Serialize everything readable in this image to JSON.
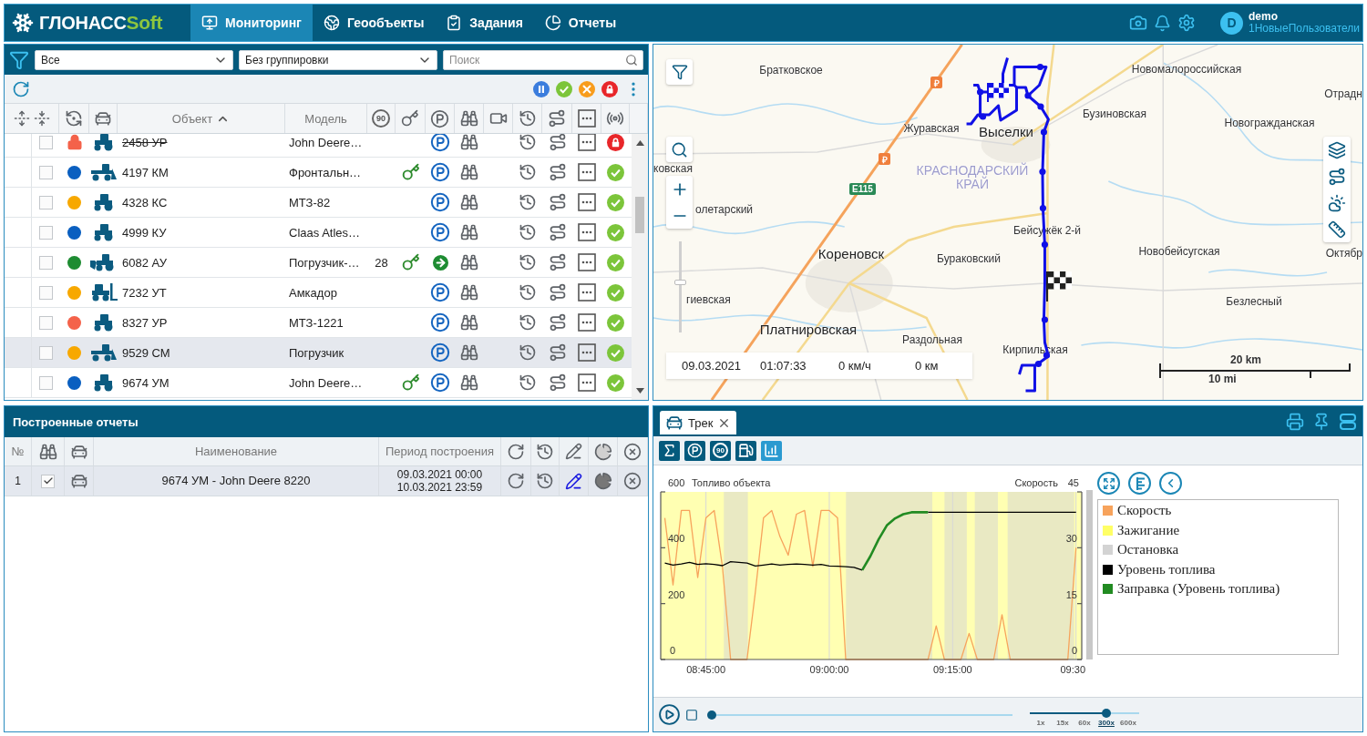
{
  "header": {
    "logo": {
      "main": "ГЛОНАСС",
      "accent": "Soft"
    },
    "nav": [
      {
        "kind": "monitoring",
        "label": "Мониторинг",
        "selected": true
      },
      {
        "kind": "geoobjects",
        "label": "Геообъекты",
        "selected": false
      },
      {
        "kind": "tasks",
        "label": "Задания",
        "selected": false
      },
      {
        "kind": "reports",
        "label": "Отчеты",
        "selected": false
      }
    ],
    "user": {
      "initial": "D",
      "name": "demo",
      "group": "1НовыеПользователи"
    }
  },
  "monitoring": {
    "filters": {
      "status": "Все",
      "grouping": "Без группировки",
      "search": {
        "placeholder": "Поиск"
      }
    },
    "table": {
      "columns": {
        "object": "Объект",
        "model": "Модель",
        "speed_limit": "90"
      },
      "sort_ascending": true,
      "rows": [
        {
          "name": "2458 УР",
          "model": "John Deere…",
          "kind": "tractor",
          "color": "#f4624a",
          "blocked": true,
          "key": false,
          "moving": false,
          "checked": false,
          "selected": false
        },
        {
          "name": "4197 КМ",
          "model": "Фронтальн…",
          "kind": "grader",
          "color": "#0a5fc0",
          "blocked": false,
          "key": true,
          "moving": false,
          "checked": false,
          "selected": false
        },
        {
          "name": "4328 КС",
          "model": "МТЗ-82",
          "kind": "tractor",
          "color": "#f7a800",
          "blocked": false,
          "key": false,
          "moving": false,
          "checked": false,
          "selected": false
        },
        {
          "name": "4999 КУ",
          "model": "Claas Atles…",
          "kind": "tractor",
          "color": "#0a5fc0",
          "blocked": false,
          "key": false,
          "moving": false,
          "checked": false,
          "selected": false
        },
        {
          "name": "6082 АУ",
          "model": "Погрузчик-…",
          "speed_limit": "28",
          "kind": "loader",
          "color": "#1e8c32",
          "blocked": false,
          "key": true,
          "moving": true,
          "checked": false,
          "selected": false
        },
        {
          "name": "7232 УТ",
          "model": "Амкадор",
          "kind": "forklift",
          "color": "#f7a800",
          "blocked": false,
          "key": false,
          "moving": false,
          "checked": false,
          "selected": false
        },
        {
          "name": "8327 УР",
          "model": "МТЗ-1221",
          "kind": "tractor",
          "color": "#f4624a",
          "blocked": false,
          "key": false,
          "moving": false,
          "checked": false,
          "selected": false
        },
        {
          "name": "9529 СМ",
          "model": "Погрузчик",
          "kind": "grader",
          "color": "#f7a800",
          "blocked": false,
          "key": false,
          "moving": false,
          "checked": false,
          "selected": true
        },
        {
          "name": "9674 УМ",
          "model": "John Deere…",
          "kind": "tractor",
          "color": "#0a5fc0",
          "blocked": false,
          "key": true,
          "moving": false,
          "checked": false,
          "selected": false
        }
      ]
    }
  },
  "map": {
    "places": [
      {
        "label": "Братковское",
        "kind": "village"
      },
      {
        "label": "Новомалороссийская",
        "kind": "village"
      },
      {
        "label": "Отрадн",
        "kind": "village"
      },
      {
        "label": "Журавская",
        "kind": "village"
      },
      {
        "label": "Выселки",
        "kind": "city"
      },
      {
        "label": "Бузиновская",
        "kind": "village"
      },
      {
        "label": "Новогражданская",
        "kind": "village"
      },
      {
        "label": "ковская",
        "kind": "village"
      },
      {
        "label": "КРАСНОДАРСКИЙ КРАЙ",
        "kind": "region"
      },
      {
        "label": "олетарский",
        "kind": "village"
      },
      {
        "label": "Кореновск",
        "kind": "city"
      },
      {
        "label": "Бураковский",
        "kind": "village"
      },
      {
        "label": "Бейсужёк 2-й",
        "kind": "village"
      },
      {
        "label": "Новобейсугская",
        "kind": "village"
      },
      {
        "label": "Октябр",
        "kind": "village"
      },
      {
        "label": "гиевская",
        "kind": "village"
      },
      {
        "label": "Безлесный",
        "kind": "village"
      },
      {
        "label": "Платнировская",
        "kind": "city"
      },
      {
        "label": "Раздольная",
        "kind": "village"
      },
      {
        "label": "Кирпильская",
        "kind": "village"
      }
    ],
    "road_sign": "E115",
    "fuel_markers": [
      "₽",
      "₽"
    ],
    "zoom_slider": {
      "level": 0.55
    },
    "info": {
      "date": "09.03.2021",
      "time": "01:07:33",
      "speed": "0 км/ч",
      "distance": "0 км"
    },
    "scale": {
      "metric": "20 km",
      "imperial": "10 mi"
    }
  },
  "reports": {
    "title": "Построенные отчеты",
    "columns": {
      "number": "№",
      "name": "Наименование",
      "period": "Период построения"
    },
    "rows": [
      {
        "number": "1",
        "checked": true,
        "selected": true,
        "name": "9674 УМ - John Deere 8220",
        "period_from": "09.03.2021 00:00",
        "period_to": "10.03.2021 23:59",
        "track_shown": true
      }
    ]
  },
  "track": {
    "tab": {
      "label": "Трек",
      "selected": true
    },
    "tools": [
      {
        "kind": "sum",
        "selected": false
      },
      {
        "kind": "parking",
        "selected": false
      },
      {
        "kind": "speed",
        "label": "90",
        "selected": false
      },
      {
        "kind": "fuel",
        "selected": false
      },
      {
        "kind": "chart",
        "selected": true
      }
    ],
    "chart": {
      "chart_data": {
        "type": "line",
        "ylabel": "Топливо объекта",
        "y2label": "Скорость",
        "grid": true,
        "legend": "right",
        "categories": [
          null,
          null,
          null,
          null,
          null,
          "08:45:00",
          null,
          null,
          null,
          null,
          null,
          null,
          null,
          null,
          null,
          null,
          null,
          null,
          null,
          null,
          "09:00:00",
          null,
          null,
          null,
          null,
          null,
          null,
          null,
          null,
          null,
          null,
          null,
          null,
          null,
          null,
          "09:15:00",
          null,
          null,
          null,
          null,
          null,
          null,
          null,
          null,
          null,
          null,
          null,
          null,
          null,
          null,
          "09:30"
        ],
        "ylim": [
          0,
          600
        ],
        "yticks": [
          0,
          200,
          400,
          600
        ],
        "y2lim": [
          0,
          45
        ],
        "y2ticks": [
          0,
          15,
          30,
          45
        ],
        "series": [
          {
            "name": "Скорость",
            "color": "#f7a35c",
            "axis": "y2",
            "values": [
              38,
              20,
              40,
              40,
              22,
              38,
              40,
              25,
              0,
              0,
              0,
              18,
              38,
              40,
              33,
              28,
              39,
              40,
              25,
              40,
              40,
              38,
              0,
              0,
              0,
              0,
              0,
              0,
              0,
              0,
              0,
              0,
              0,
              9,
              0,
              0,
              0,
              7,
              0,
              0,
              0,
              12,
              0,
              0,
              0,
              0,
              0,
              0,
              0,
              0,
              30
            ]
          },
          {
            "name": "Уровень топлива",
            "color": "#000000",
            "axis": "y",
            "values": [
              345,
              338,
              342,
              348,
              340,
              343,
              340,
              336,
              350,
              348,
              345,
              335,
              338,
              342,
              338,
              340,
              342,
              340,
              338,
              340,
              335,
              334,
              332,
              330,
              320,
              null,
              null,
              null,
              null,
              null,
              null,
              null,
              527,
              527,
              527,
              527,
              527,
              527,
              527,
              527,
              527,
              527,
              527,
              527,
              527,
              527,
              527,
              527,
              527,
              527,
              527
            ]
          },
          {
            "name": "Заправка (Уровень топлива)",
            "color": "#228b22",
            "axis": "y",
            "values": [
              null,
              null,
              null,
              null,
              null,
              null,
              null,
              null,
              null,
              null,
              null,
              null,
              null,
              null,
              null,
              null,
              null,
              null,
              null,
              null,
              null,
              null,
              null,
              null,
              320,
              370,
              430,
              480,
              505,
              520,
              527,
              527,
              527,
              null,
              null,
              null,
              null,
              null,
              null,
              null,
              null,
              null,
              null,
              null,
              null,
              null,
              null,
              null,
              null,
              null,
              null
            ]
          }
        ]
      },
      "band_legend": [
        {
          "label": "Зажигание",
          "color": "#ffff66"
        },
        {
          "label": "Остановка",
          "color": "#d3d3d3"
        }
      ]
    },
    "playback": {
      "level": 0,
      "speeds": [
        {
          "label": "1x",
          "selected": false
        },
        {
          "label": "15x",
          "selected": false
        },
        {
          "label": "60x",
          "selected": false
        },
        {
          "label": "300x",
          "selected": true
        },
        {
          "label": "600x",
          "selected": false
        }
      ]
    }
  }
}
